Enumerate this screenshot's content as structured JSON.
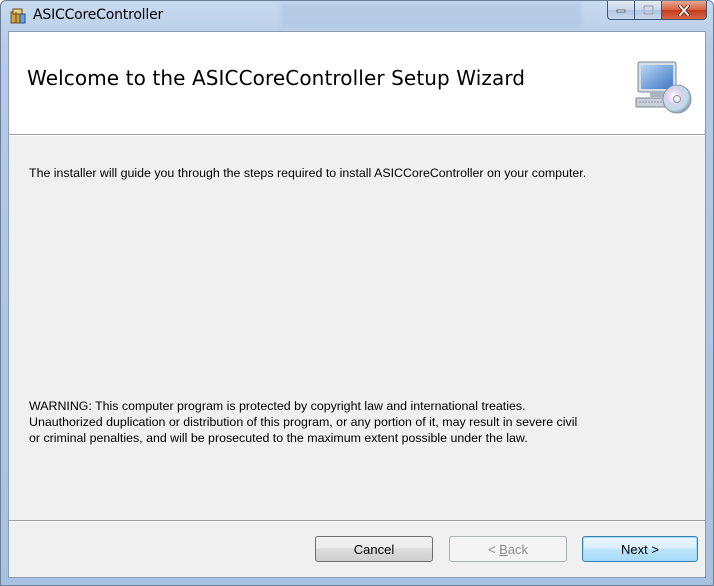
{
  "window": {
    "title": "ASICCoreController",
    "app_icon": "installer-package-icon",
    "controls": {
      "minimize_icon": "minimize-icon",
      "maximize_icon": "maximize-icon",
      "close_icon": "close-icon"
    }
  },
  "banner": {
    "title": "Welcome to the ASICCoreController Setup Wizard",
    "icon": "computer-with-disc-icon"
  },
  "body": {
    "intro": "The installer will guide you through the steps required to install ASICCoreController on your computer.",
    "warning_lines": [
      "WARNING: This computer program is protected by copyright law and international treaties.",
      "Unauthorized duplication or distribution of this program, or any portion of it, may result in severe civil",
      "or criminal penalties, and will be prosecuted to the maximum extent possible under the law."
    ]
  },
  "buttons": {
    "cancel": "Cancel",
    "back_prefix": "< ",
    "back_accel": "B",
    "back_rest": "ack",
    "next": "Next >"
  },
  "colors": {
    "titlebar": "#b5cbe6",
    "close_button": "#c4391a",
    "default_button_border": "#3c7fb1",
    "disabled_text": "#8c8c8c"
  }
}
